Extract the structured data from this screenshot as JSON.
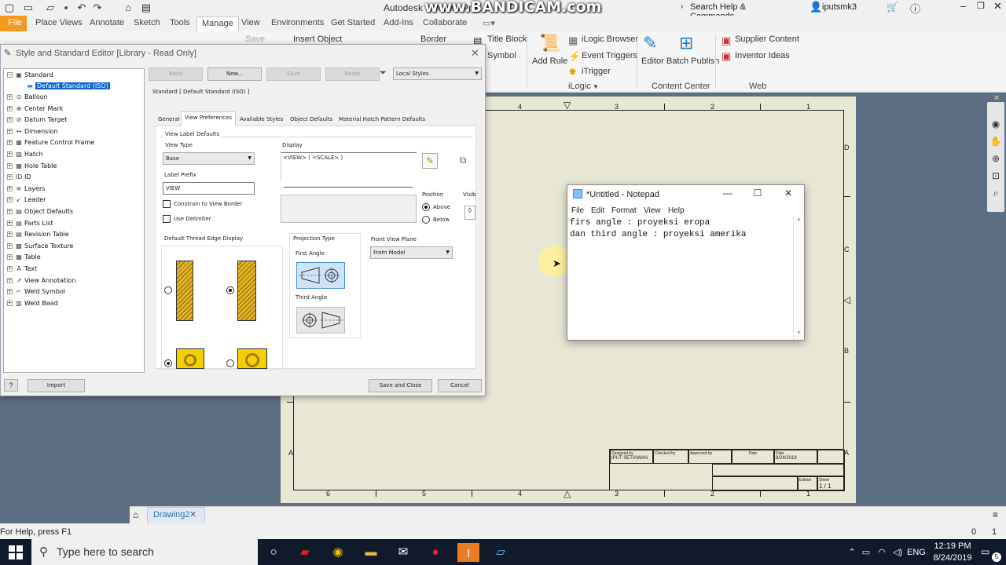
{
  "qat": {
    "app_title": "Autodesk Inventor Pro",
    "search_placeholder": "Search Help & Commands...",
    "user": "iputsmk3",
    "watermark": "www.BANDICAM.com"
  },
  "menu_tabs": [
    "File",
    "Place Views",
    "Annotate",
    "Sketch",
    "Tools",
    "Manage",
    "View",
    "Environments",
    "Get Started",
    "Add-Ins",
    "Collaborate"
  ],
  "ribbon": {
    "partial": [
      "Insert Object",
      "Border",
      "Title Block",
      "Symbol",
      "Save"
    ],
    "ilogic": {
      "add_rule": "Add Rule",
      "browser": "iLogic Browser",
      "triggers": "Event Triggers",
      "itrigger": "iTrigger",
      "panel": "iLogic"
    },
    "content_center": {
      "editor": "Editor",
      "batch": "Batch Publish",
      "panel": "Content Center"
    },
    "web": {
      "supplier": "Supplier Content",
      "ideas": "Inventor Ideas",
      "panel": "Web"
    }
  },
  "dialog": {
    "title": "Style and Standard Editor [Library - Read Only]",
    "tree_root": "Standard",
    "tree_selected": "Default Standard (ISO)",
    "tree_items": [
      "Balloon",
      "Center Mark",
      "Datum Target",
      "Dimension",
      "Feature Control Frame",
      "Hatch",
      "Hole Table",
      "ID",
      "Layers",
      "Leader",
      "Object Defaults",
      "Parts List",
      "Revision Table",
      "Surface Texture",
      "Table",
      "Text",
      "View Annotation",
      "Weld Symbol",
      "Weld Bead"
    ],
    "tree_icons": [
      "balloon-icon",
      "center-mark-icon",
      "datum-icon",
      "dimension-icon",
      "fcf-icon",
      "hatch-icon",
      "hole-table-icon",
      "id-icon",
      "layers-icon",
      "leader-icon",
      "object-defaults-icon",
      "parts-list-icon",
      "revision-table-icon",
      "surface-texture-icon",
      "table-icon",
      "text-icon",
      "view-annotation-icon",
      "weld-symbol-icon",
      "weld-bead-icon"
    ],
    "buttons": {
      "back": "Back",
      "new": "New...",
      "save": "Save",
      "reset": "Reset",
      "import": "Import",
      "save_close": "Save and Close",
      "cancel": "Cancel"
    },
    "filter": "Local Styles",
    "header": "Standard [ Default Standard (ISO) ]",
    "tabs": [
      "General",
      "View Preferences",
      "Available Styles",
      "Object Defaults",
      "Material Hatch Pattern Defaults"
    ],
    "active_tab": "View Preferences",
    "view_label_defaults": "View Label Defaults",
    "view_type_label": "View Type",
    "view_type_value": "Base",
    "label_prefix_label": "Label Prefix",
    "label_prefix_value": "VIEW",
    "constrain": "Constrain to View Border",
    "use_delimiter": "Use Delimiter",
    "display_label": "Display",
    "display_value": "<VIEW> ( <SCALE> )",
    "position_label": "Position",
    "above": "Above",
    "below": "Below",
    "visibility_label": "Visib",
    "thread_label": "Default Thread Edge Display",
    "projection_label": "Projection Type",
    "first_angle": "First Angle",
    "third_angle": "Third Angle",
    "front_plane_label": "Front View Plane",
    "front_plane_value": "From Model"
  },
  "notepad": {
    "title": "*Untitled - Notepad",
    "menu": [
      "File",
      "Edit",
      "Format",
      "View",
      "Help"
    ],
    "text": "firs angle : proyeksi eropa\ndan third angle : proyeksi amerika"
  },
  "sheet": {
    "col_labels_top": [
      "4",
      "3",
      "2",
      "1"
    ],
    "col_labels_bottom": [
      "6",
      "5",
      "4",
      "3",
      "2",
      "1"
    ],
    "row_labels": [
      "D",
      "C",
      "B",
      "A"
    ],
    "title_block": {
      "designed_by": "Designed by",
      "checked_by": "Checked by",
      "approved_by": "Approved by",
      "date_label": "Date",
      "date2_label": "Date",
      "designer": "IPUT SETIAWAN",
      "date": "8/24/2019",
      "edition": "Edition",
      "sheet_label": "Sheet",
      "sheet": "1 / 1"
    }
  },
  "doc_tab": "Drawing2",
  "status": {
    "help": "For Help, press F1",
    "count_a": "0",
    "count_b": "1"
  },
  "taskbar": {
    "search": "Type here to search",
    "lang": "ENG",
    "time": "12:19 PM",
    "date": "8/24/2019",
    "notifications": "5"
  },
  "colors": {
    "file_tab": "#f39a1e",
    "selection": "#0a64cf",
    "taskbar": "#101a2a",
    "sheet": "#e8e6d5"
  }
}
